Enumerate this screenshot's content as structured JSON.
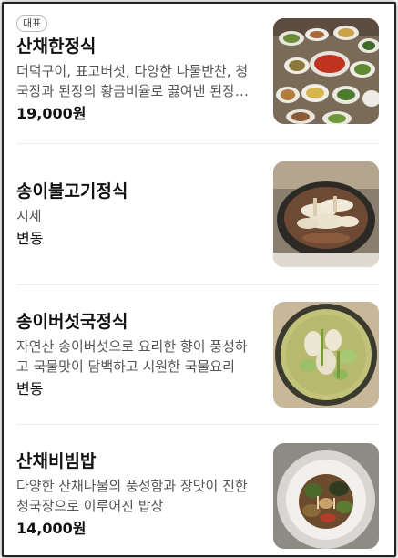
{
  "menu": {
    "items": [
      {
        "badge": "대표",
        "name": "산채한정식",
        "description": "더덕구이, 표고버섯, 다양한 나물반찬, 청국장과 된장의 황금비율로 끓여낸 된장찌개",
        "price": "19,000원",
        "image_icon": "korean-table-set-photo"
      },
      {
        "badge": "",
        "name": "송이불고기정식",
        "description": "시세",
        "price": "변동",
        "image_icon": "bulgogi-hotpot-photo"
      },
      {
        "badge": "",
        "name": "송이버섯국정식",
        "description": "자연산 송이버섯으로 요리한 향이 풍성하고 국물맛이 담백하고 시원한 국물요리",
        "price": "변동",
        "image_icon": "mushroom-soup-photo"
      },
      {
        "badge": "",
        "name": "산채비빔밥",
        "description": "다양한 산채나물의 풍성함과 장맛이 진한 청국장으로 이루어진 밥상",
        "price": "14,000원",
        "image_icon": "bibimbap-bowl-photo"
      }
    ]
  }
}
